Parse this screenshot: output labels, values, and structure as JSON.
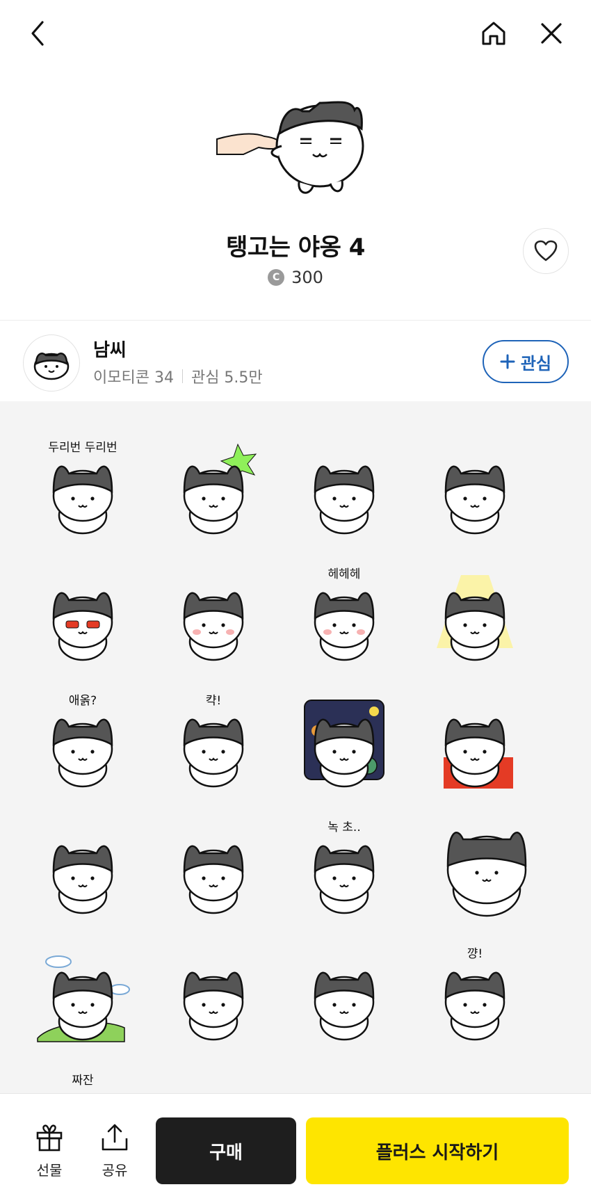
{
  "header": {
    "back_icon": "chevron-left-icon",
    "home_icon": "home-icon",
    "close_icon": "close-icon"
  },
  "product": {
    "title": "탱고는 야옹 4",
    "coin_symbol": "C",
    "price": "300",
    "like_icon": "heart-outline-icon"
  },
  "author": {
    "name": "남씨",
    "emoticon_count": "이모티콘 34",
    "follower_count": "관심 5.5만",
    "follow_label": "관심",
    "follow_icon": "plus-icon"
  },
  "stickers": [
    {
      "caption": "두리번 두리번"
    },
    {
      "caption": ""
    },
    {
      "caption": ""
    },
    {
      "caption": ""
    },
    {
      "caption": ""
    },
    {
      "caption": ""
    },
    {
      "caption": "헤헤헤"
    },
    {
      "caption": ""
    },
    {
      "caption": "애옭?"
    },
    {
      "caption": "캭!"
    },
    {
      "caption": ""
    },
    {
      "caption": ""
    },
    {
      "caption": ""
    },
    {
      "caption": ""
    },
    {
      "caption": "녹 초.."
    },
    {
      "caption": ""
    },
    {
      "caption": ""
    },
    {
      "caption": ""
    },
    {
      "caption": ""
    },
    {
      "caption": "꺙!"
    },
    {
      "caption": "짜잔"
    },
    {
      "caption": ""
    },
    {
      "caption": ""
    },
    {
      "caption": ""
    }
  ],
  "bottom": {
    "gift_label": "선물",
    "share_label": "공유",
    "buy_label": "구매",
    "plus_label": "플러스 시작하기"
  },
  "colors": {
    "accent_yellow": "#fee500",
    "follow_blue": "#1e63b8",
    "buy_black": "#1e1e1e",
    "grid_bg": "#f4f4f4"
  }
}
